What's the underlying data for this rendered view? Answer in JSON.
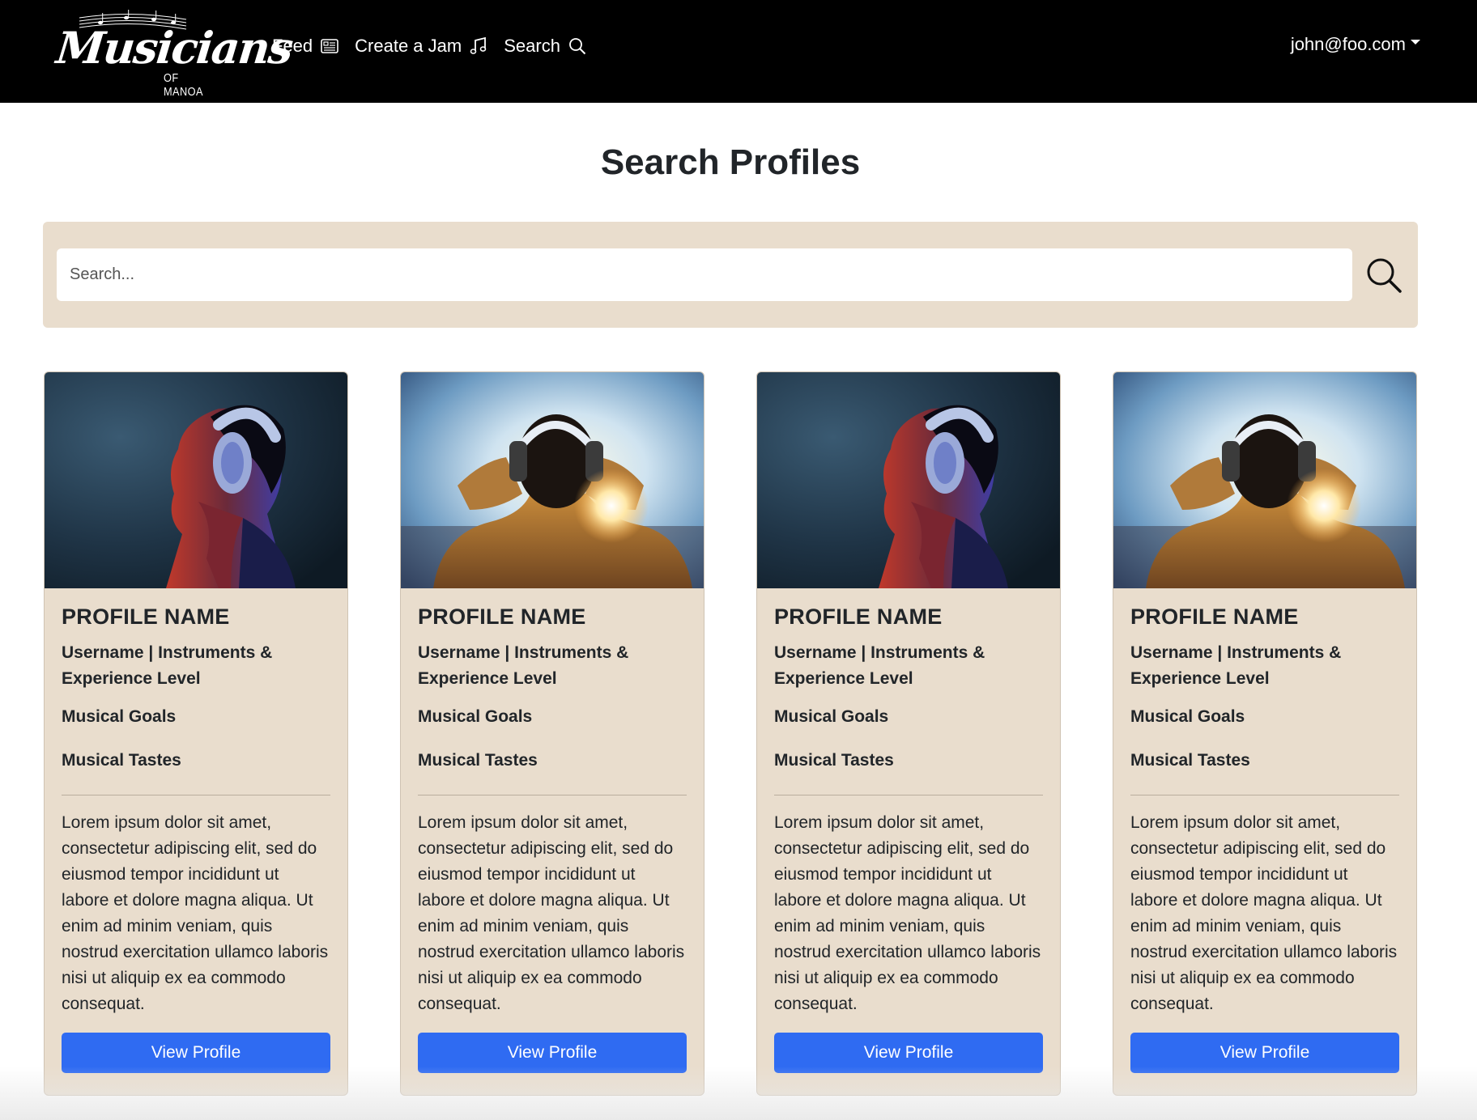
{
  "navbar": {
    "brand": {
      "title": "Musicians",
      "subtitle": "OF MANOA"
    },
    "links": [
      {
        "label": "Feed",
        "icon": "newspaper-icon"
      },
      {
        "label": "Create a Jam",
        "icon": "music-note-icon"
      },
      {
        "label": "Search",
        "icon": "search-icon"
      }
    ],
    "user": {
      "email": "john@foo.com"
    },
    "background": "#000000"
  },
  "page": {
    "title": "Search Profiles"
  },
  "search": {
    "placeholder": "Search...",
    "value": "",
    "panel_color": "#e9ddcd"
  },
  "colors": {
    "card_bg": "#e9ddcd",
    "button": "#2f6bf2"
  },
  "cards": [
    {
      "image": "woman-headphones-photo",
      "name": "PROFILE NAME",
      "subtitle": "Username | Instruments & Experience Level",
      "goals": "Musical Goals",
      "tastes": "Musical Tastes",
      "bio": "Lorem ipsum dolor sit amet, consectetur adipiscing elit, sed do eiusmod tempor incididunt ut labore et dolore magna aliqua. Ut enim ad minim veniam, quis nostrud exercitation ullamco laboris nisi ut aliquip ex ea commodo consequat.",
      "button": "View Profile"
    },
    {
      "image": "man-headphones-sunset-photo",
      "name": "PROFILE NAME",
      "subtitle": "Username | Instruments & Experience Level",
      "goals": "Musical Goals",
      "tastes": "Musical Tastes",
      "bio": "Lorem ipsum dolor sit amet, consectetur adipiscing elit, sed do eiusmod tempor incididunt ut labore et dolore magna aliqua. Ut enim ad minim veniam, quis nostrud exercitation ullamco laboris nisi ut aliquip ex ea commodo consequat.",
      "button": "View Profile"
    },
    {
      "image": "woman-headphones-photo",
      "name": "PROFILE NAME",
      "subtitle": "Username | Instruments & Experience Level",
      "goals": "Musical Goals",
      "tastes": "Musical Tastes",
      "bio": "Lorem ipsum dolor sit amet, consectetur adipiscing elit, sed do eiusmod tempor incididunt ut labore et dolore magna aliqua. Ut enim ad minim veniam, quis nostrud exercitation ullamco laboris nisi ut aliquip ex ea commodo consequat.",
      "button": "View Profile"
    },
    {
      "image": "man-headphones-sunset-photo",
      "name": "PROFILE NAME",
      "subtitle": "Username | Instruments & Experience Level",
      "goals": "Musical Goals",
      "tastes": "Musical Tastes",
      "bio": "Lorem ipsum dolor sit amet, consectetur adipiscing elit, sed do eiusmod tempor incididunt ut labore et dolore magna aliqua. Ut enim ad minim veniam, quis nostrud exercitation ullamco laboris nisi ut aliquip ex ea commodo consequat.",
      "button": "View Profile"
    }
  ]
}
